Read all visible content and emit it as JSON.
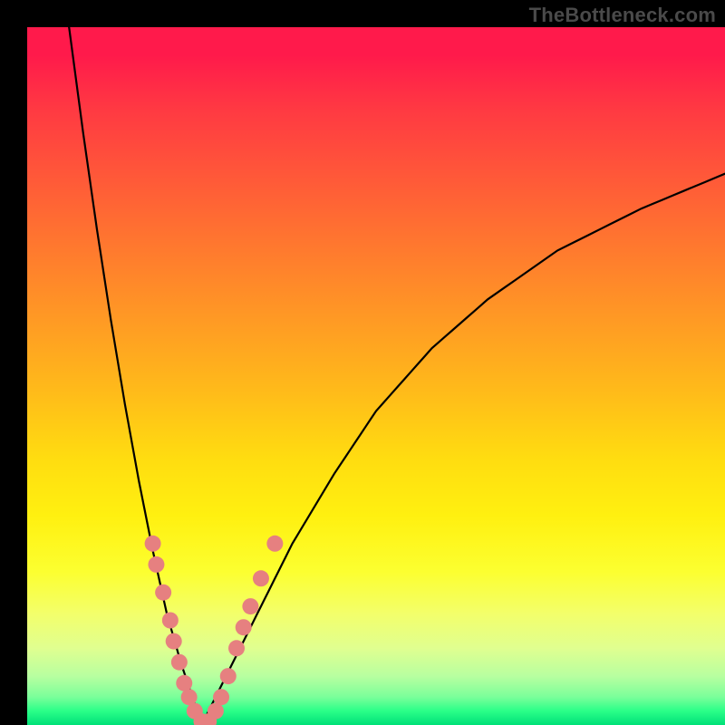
{
  "watermark": "TheBottleneck.com",
  "colors": {
    "frame": "#000000",
    "curve": "#000000",
    "marker": "#e68080",
    "gradient_top": "#ff1a4b",
    "gradient_bottom": "#00e078"
  },
  "chart_data": {
    "type": "line",
    "title": "",
    "xlabel": "",
    "ylabel": "",
    "xlim": [
      0,
      100
    ],
    "ylim": [
      0,
      100
    ],
    "note": "Axes have no visible tick labels; values are approximate positions in percent of plot area. y=0 at bottom (green), y=100 at top (red). The curve is a V-shape with minimum near x≈25.",
    "series": [
      {
        "name": "curve-left",
        "x": [
          6,
          8,
          10,
          12,
          14,
          16,
          18,
          20,
          22,
          24,
          25
        ],
        "y": [
          100,
          85,
          71,
          58,
          46,
          35,
          25,
          16,
          9,
          3,
          0
        ]
      },
      {
        "name": "curve-right",
        "x": [
          25,
          27,
          30,
          34,
          38,
          44,
          50,
          58,
          66,
          76,
          88,
          100
        ],
        "y": [
          0,
          4,
          10,
          18,
          26,
          36,
          45,
          54,
          61,
          68,
          74,
          79
        ]
      }
    ],
    "markers": {
      "name": "highlighted-points",
      "note": "Salmon dots clustered near the bottom of the V",
      "points": [
        {
          "x": 18.0,
          "y": 26
        },
        {
          "x": 18.5,
          "y": 23
        },
        {
          "x": 19.5,
          "y": 19
        },
        {
          "x": 20.5,
          "y": 15
        },
        {
          "x": 21.0,
          "y": 12
        },
        {
          "x": 21.8,
          "y": 9
        },
        {
          "x": 22.5,
          "y": 6
        },
        {
          "x": 23.2,
          "y": 4
        },
        {
          "x": 24.0,
          "y": 2
        },
        {
          "x": 25.0,
          "y": 0.5
        },
        {
          "x": 26.0,
          "y": 0.5
        },
        {
          "x": 27.0,
          "y": 2
        },
        {
          "x": 27.8,
          "y": 4
        },
        {
          "x": 28.8,
          "y": 7
        },
        {
          "x": 30.0,
          "y": 11
        },
        {
          "x": 31.0,
          "y": 14
        },
        {
          "x": 32.0,
          "y": 17
        },
        {
          "x": 33.5,
          "y": 21
        },
        {
          "x": 35.5,
          "y": 26
        }
      ]
    }
  }
}
